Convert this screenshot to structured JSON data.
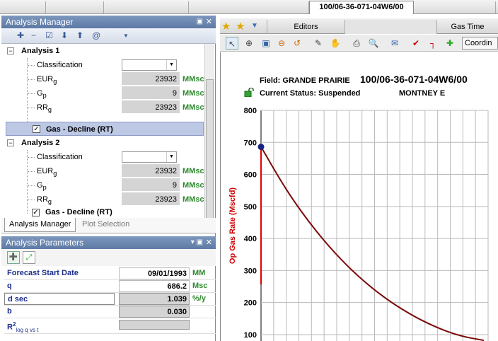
{
  "top_tabs": {
    "active": "100/06-36-071-04W6/00"
  },
  "analysis_manager": {
    "title": "Analysis Manager",
    "analyses": [
      {
        "title": "Analysis 1",
        "classification_label": "Classification",
        "params": [
          {
            "label": "EUR",
            "sub": "g",
            "value": "23932",
            "unit": "MMscf"
          },
          {
            "label": "G",
            "sub": "p",
            "value": "9",
            "unit": "MMscf"
          },
          {
            "label": "RR",
            "sub": "g",
            "value": "23923",
            "unit": "MMscf"
          }
        ],
        "method": "Gas - Decline (RT)"
      },
      {
        "title": "Analysis 2",
        "classification_label": "Classification",
        "params": [
          {
            "label": "EUR",
            "sub": "g",
            "value": "23932",
            "unit": "MMscf"
          },
          {
            "label": "G",
            "sub": "p",
            "value": "9",
            "unit": "MMscf"
          },
          {
            "label": "RR",
            "sub": "g",
            "value": "23923",
            "unit": "MMscf"
          }
        ],
        "method": "Gas - Decline (RT)"
      }
    ],
    "tabs": [
      "Analysis Manager",
      "Plot Selection"
    ]
  },
  "analysis_parameters": {
    "title": "Analysis Parameters",
    "rows": [
      {
        "label": "Forecast Start Date",
        "value": "09/01/1993",
        "unit": "MM"
      },
      {
        "label": "q",
        "value": "686.2",
        "unit": "Msc"
      },
      {
        "label": "d sec",
        "value": "1.039",
        "unit": "%/y"
      },
      {
        "label": "b",
        "value": "0.030",
        "unit": ""
      },
      {
        "label": "R",
        "sup": "2",
        "sub": "log q vs t",
        "value": "",
        "unit": ""
      }
    ]
  },
  "right_toolbar": {
    "tabs": [
      "Editors",
      "Gas Time"
    ],
    "coord_label": "Coordin"
  },
  "plot": {
    "field": "Field: GRANDE PRAIRIE",
    "well": "100/06-36-071-04W6/00",
    "status": "Current Status: Suspended",
    "formation": "MONTNEY E"
  },
  "chart_data": {
    "type": "line",
    "ylabel": "Op Gas Rate (Mscfd)",
    "y_ticks": [
      100,
      200,
      300,
      400,
      500,
      600,
      700,
      800
    ],
    "ylim": [
      80,
      800
    ],
    "grid": true,
    "series": [
      {
        "values": [
          [
            0,
            686.2
          ],
          [
            5,
            553
          ],
          [
            10,
            444
          ],
          [
            15,
            352
          ],
          [
            20,
            276
          ],
          [
            25,
            214
          ],
          [
            30,
            164
          ],
          [
            35,
            125
          ],
          [
            40,
            96
          ],
          [
            45,
            82
          ]
        ]
      }
    ],
    "marker": {
      "x": 0,
      "y": 686.2
    },
    "colors": {
      "forecast": "#7a0a0a",
      "history": "#e00000",
      "marker": "#1a237e",
      "ylabel": "#cc0000"
    }
  }
}
